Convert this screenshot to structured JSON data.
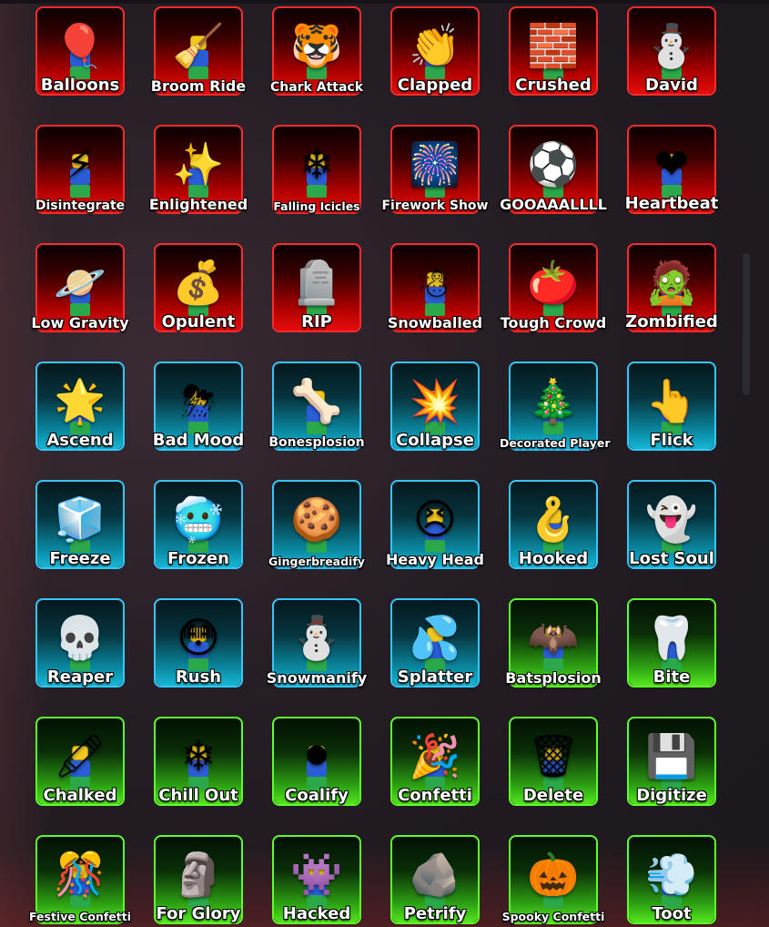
{
  "items": [
    {
      "label": "Balloons",
      "rarity": "red",
      "icon": "balloon-icon",
      "glyph": "🎈"
    },
    {
      "label": "Broom Ride",
      "rarity": "red",
      "icon": "broom-icon",
      "glyph": "🧹"
    },
    {
      "label": "Chark Attack",
      "rarity": "red",
      "icon": "chark-icon",
      "glyph": "🐯"
    },
    {
      "label": "Clapped",
      "rarity": "red",
      "icon": "clap-icon",
      "glyph": "👏"
    },
    {
      "label": "Crushed",
      "rarity": "red",
      "icon": "rubble-icon",
      "glyph": "🧱"
    },
    {
      "label": "David",
      "rarity": "red",
      "icon": "snowman-icon",
      "glyph": "⛄"
    },
    {
      "label": "Disintegrate",
      "rarity": "red",
      "icon": "laser-icon",
      "glyph": "⚡"
    },
    {
      "label": "Enlightened",
      "rarity": "red",
      "icon": "glow-icon",
      "glyph": "✨"
    },
    {
      "label": "Falling Icicles",
      "rarity": "red",
      "icon": "icicle-icon",
      "glyph": "❄"
    },
    {
      "label": "Firework Show",
      "rarity": "red",
      "icon": "firework-icon",
      "glyph": "🎆"
    },
    {
      "label": "GOOAAALLLL",
      "rarity": "red",
      "icon": "soccer-icon",
      "glyph": "⚽"
    },
    {
      "label": "Heartbeat",
      "rarity": "red",
      "icon": "heart-icon",
      "glyph": "❤"
    },
    {
      "label": "Low Gravity",
      "rarity": "red",
      "icon": "astronaut-icon",
      "glyph": "🪐"
    },
    {
      "label": "Opulent",
      "rarity": "red",
      "icon": "gold-icon",
      "glyph": "💰"
    },
    {
      "label": "RIP",
      "rarity": "red",
      "icon": "tombstone-icon",
      "glyph": "🪦"
    },
    {
      "label": "Snowballed",
      "rarity": "red",
      "icon": "snowball-icon",
      "glyph": "☃"
    },
    {
      "label": "Tough Crowd",
      "rarity": "red",
      "icon": "tomato-icon",
      "glyph": "🍅"
    },
    {
      "label": "Zombified",
      "rarity": "red",
      "icon": "zombie-icon",
      "glyph": "🧟"
    },
    {
      "label": "Ascend",
      "rarity": "blue",
      "icon": "ascend-icon",
      "glyph": "🌟"
    },
    {
      "label": "Bad Mood",
      "rarity": "blue",
      "icon": "storm-cloud-icon",
      "glyph": "⛈"
    },
    {
      "label": "Bonesplosion",
      "rarity": "blue",
      "icon": "bone-icon",
      "glyph": "🦴"
    },
    {
      "label": "Collapse",
      "rarity": "blue",
      "icon": "sparkle-icon",
      "glyph": "💥"
    },
    {
      "label": "Decorated Player",
      "rarity": "blue",
      "icon": "christmas-tree-icon",
      "glyph": "🎄"
    },
    {
      "label": "Flick",
      "rarity": "blue",
      "icon": "glove-icon",
      "glyph": "👆"
    },
    {
      "label": "Freeze",
      "rarity": "blue",
      "icon": "ice-icon",
      "glyph": "🧊"
    },
    {
      "label": "Frozen",
      "rarity": "blue",
      "icon": "frozen-icon",
      "glyph": "🥶"
    },
    {
      "label": "Gingerbreadify",
      "rarity": "blue",
      "icon": "gingerbread-icon",
      "glyph": "🍪"
    },
    {
      "label": "Heavy Head",
      "rarity": "blue",
      "icon": "heavy-head-icon",
      "glyph": "😣"
    },
    {
      "label": "Hooked",
      "rarity": "blue",
      "icon": "hook-icon",
      "glyph": "🪝"
    },
    {
      "label": "Lost Soul",
      "rarity": "blue",
      "icon": "ghost-icon",
      "glyph": "👻"
    },
    {
      "label": "Reaper",
      "rarity": "blue",
      "icon": "scythe-icon",
      "glyph": "💀"
    },
    {
      "label": "Rush",
      "rarity": "blue",
      "icon": "rush-icon",
      "glyph": "😳"
    },
    {
      "label": "Snowmanify",
      "rarity": "blue",
      "icon": "snowman-hat-icon",
      "glyph": "⛄"
    },
    {
      "label": "Splatter",
      "rarity": "blue",
      "icon": "splatter-icon",
      "glyph": "💦"
    },
    {
      "label": "Batsplosion",
      "rarity": "green",
      "icon": "bat-icon",
      "glyph": "🦇"
    },
    {
      "label": "Bite",
      "rarity": "green",
      "icon": "fangs-icon",
      "glyph": "🦷"
    },
    {
      "label": "Chalked",
      "rarity": "green",
      "icon": "chalk-outline-icon",
      "glyph": "🖍"
    },
    {
      "label": "Chill Out",
      "rarity": "green",
      "icon": "snowflake-icon",
      "glyph": "❄"
    },
    {
      "label": "Coalify",
      "rarity": "green",
      "icon": "coal-icon",
      "glyph": "⚫"
    },
    {
      "label": "Confetti",
      "rarity": "green",
      "icon": "confetti-icon",
      "glyph": "🎉"
    },
    {
      "label": "Delete",
      "rarity": "green",
      "icon": "delete-menu-icon",
      "glyph": "🗑"
    },
    {
      "label": "Digitize",
      "rarity": "green",
      "icon": "digitize-icon",
      "glyph": "💾"
    },
    {
      "label": "Festive Confetti",
      "rarity": "green",
      "icon": "festive-confetti-icon",
      "glyph": "🎊"
    },
    {
      "label": "For Glory",
      "rarity": "green",
      "icon": "statue-icon",
      "glyph": "🗿"
    },
    {
      "label": "Hacked",
      "rarity": "green",
      "icon": "glitch-icon",
      "glyph": "👾"
    },
    {
      "label": "Petrify",
      "rarity": "green",
      "icon": "stone-icon",
      "glyph": "🪨"
    },
    {
      "label": "Spooky Confetti",
      "rarity": "green",
      "icon": "pumpkin-confetti-icon",
      "glyph": "🎃"
    },
    {
      "label": "Toot",
      "rarity": "green",
      "icon": "toot-icon",
      "glyph": "💨"
    }
  ],
  "colors": {
    "red_border": "#ff2a2a",
    "blue_border": "#33c6ff",
    "green_border": "#5cff29",
    "label_text": "#ffffff"
  }
}
